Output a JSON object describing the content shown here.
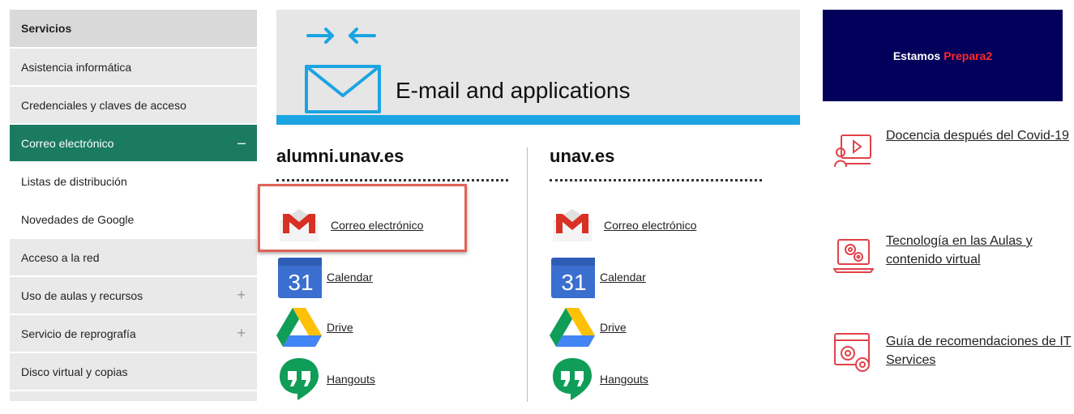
{
  "sidebar": {
    "header": "Servicios",
    "items": [
      {
        "label": "Asistencia informática",
        "mark": ""
      },
      {
        "label": "Credenciales y claves de acceso",
        "mark": ""
      },
      {
        "label": "Correo electrónico",
        "mark": "–"
      },
      {
        "label": "Listas de distribución",
        "mark": ""
      },
      {
        "label": "Novedades de Google",
        "mark": ""
      },
      {
        "label": "Acceso a la red",
        "mark": ""
      },
      {
        "label": "Uso de aulas y recursos",
        "mark": "+"
      },
      {
        "label": "Servicio de reprografía",
        "mark": "+"
      },
      {
        "label": "Disco virtual y copias",
        "mark": ""
      }
    ]
  },
  "banner": {
    "title": "E-mail and applications",
    "accent_color": "#1ba4e2"
  },
  "columns": [
    {
      "title": "alumni.unav.es",
      "apps": [
        {
          "label": "Correo electrónico",
          "icon": "gmail-icon"
        },
        {
          "label": "Calendar",
          "icon": "calendar-icon",
          "icon_text": "31"
        },
        {
          "label": "Drive",
          "icon": "drive-icon"
        },
        {
          "label": "Hangouts",
          "icon": "hangouts-icon"
        }
      ]
    },
    {
      "title": "unav.es",
      "apps": [
        {
          "label": "Correo electrónico",
          "icon": "gmail-icon"
        },
        {
          "label": "Calendar",
          "icon": "calendar-icon",
          "icon_text": "31"
        },
        {
          "label": "Drive",
          "icon": "drive-icon"
        },
        {
          "label": "Hangouts",
          "icon": "hangouts-icon"
        }
      ]
    }
  ],
  "promo": {
    "text": "Estamos",
    "highlight": "Prepara2",
    "bg_color": "#02005a",
    "highlight_color": "#ff2a2a"
  },
  "links": [
    {
      "label": "Docencia después del Covid-19",
      "icon": "online-teaching-icon"
    },
    {
      "label": "Tecnología en las Aulas y contenido virtual",
      "icon": "classroom-tech-icon"
    },
    {
      "label": "Guía de recomendaciones de IT Services",
      "icon": "settings-guide-icon"
    }
  ],
  "colors": {
    "sidebar_active": "#1b7a62",
    "highlight_border": "#e06257",
    "link_icon": "#e0424a"
  }
}
